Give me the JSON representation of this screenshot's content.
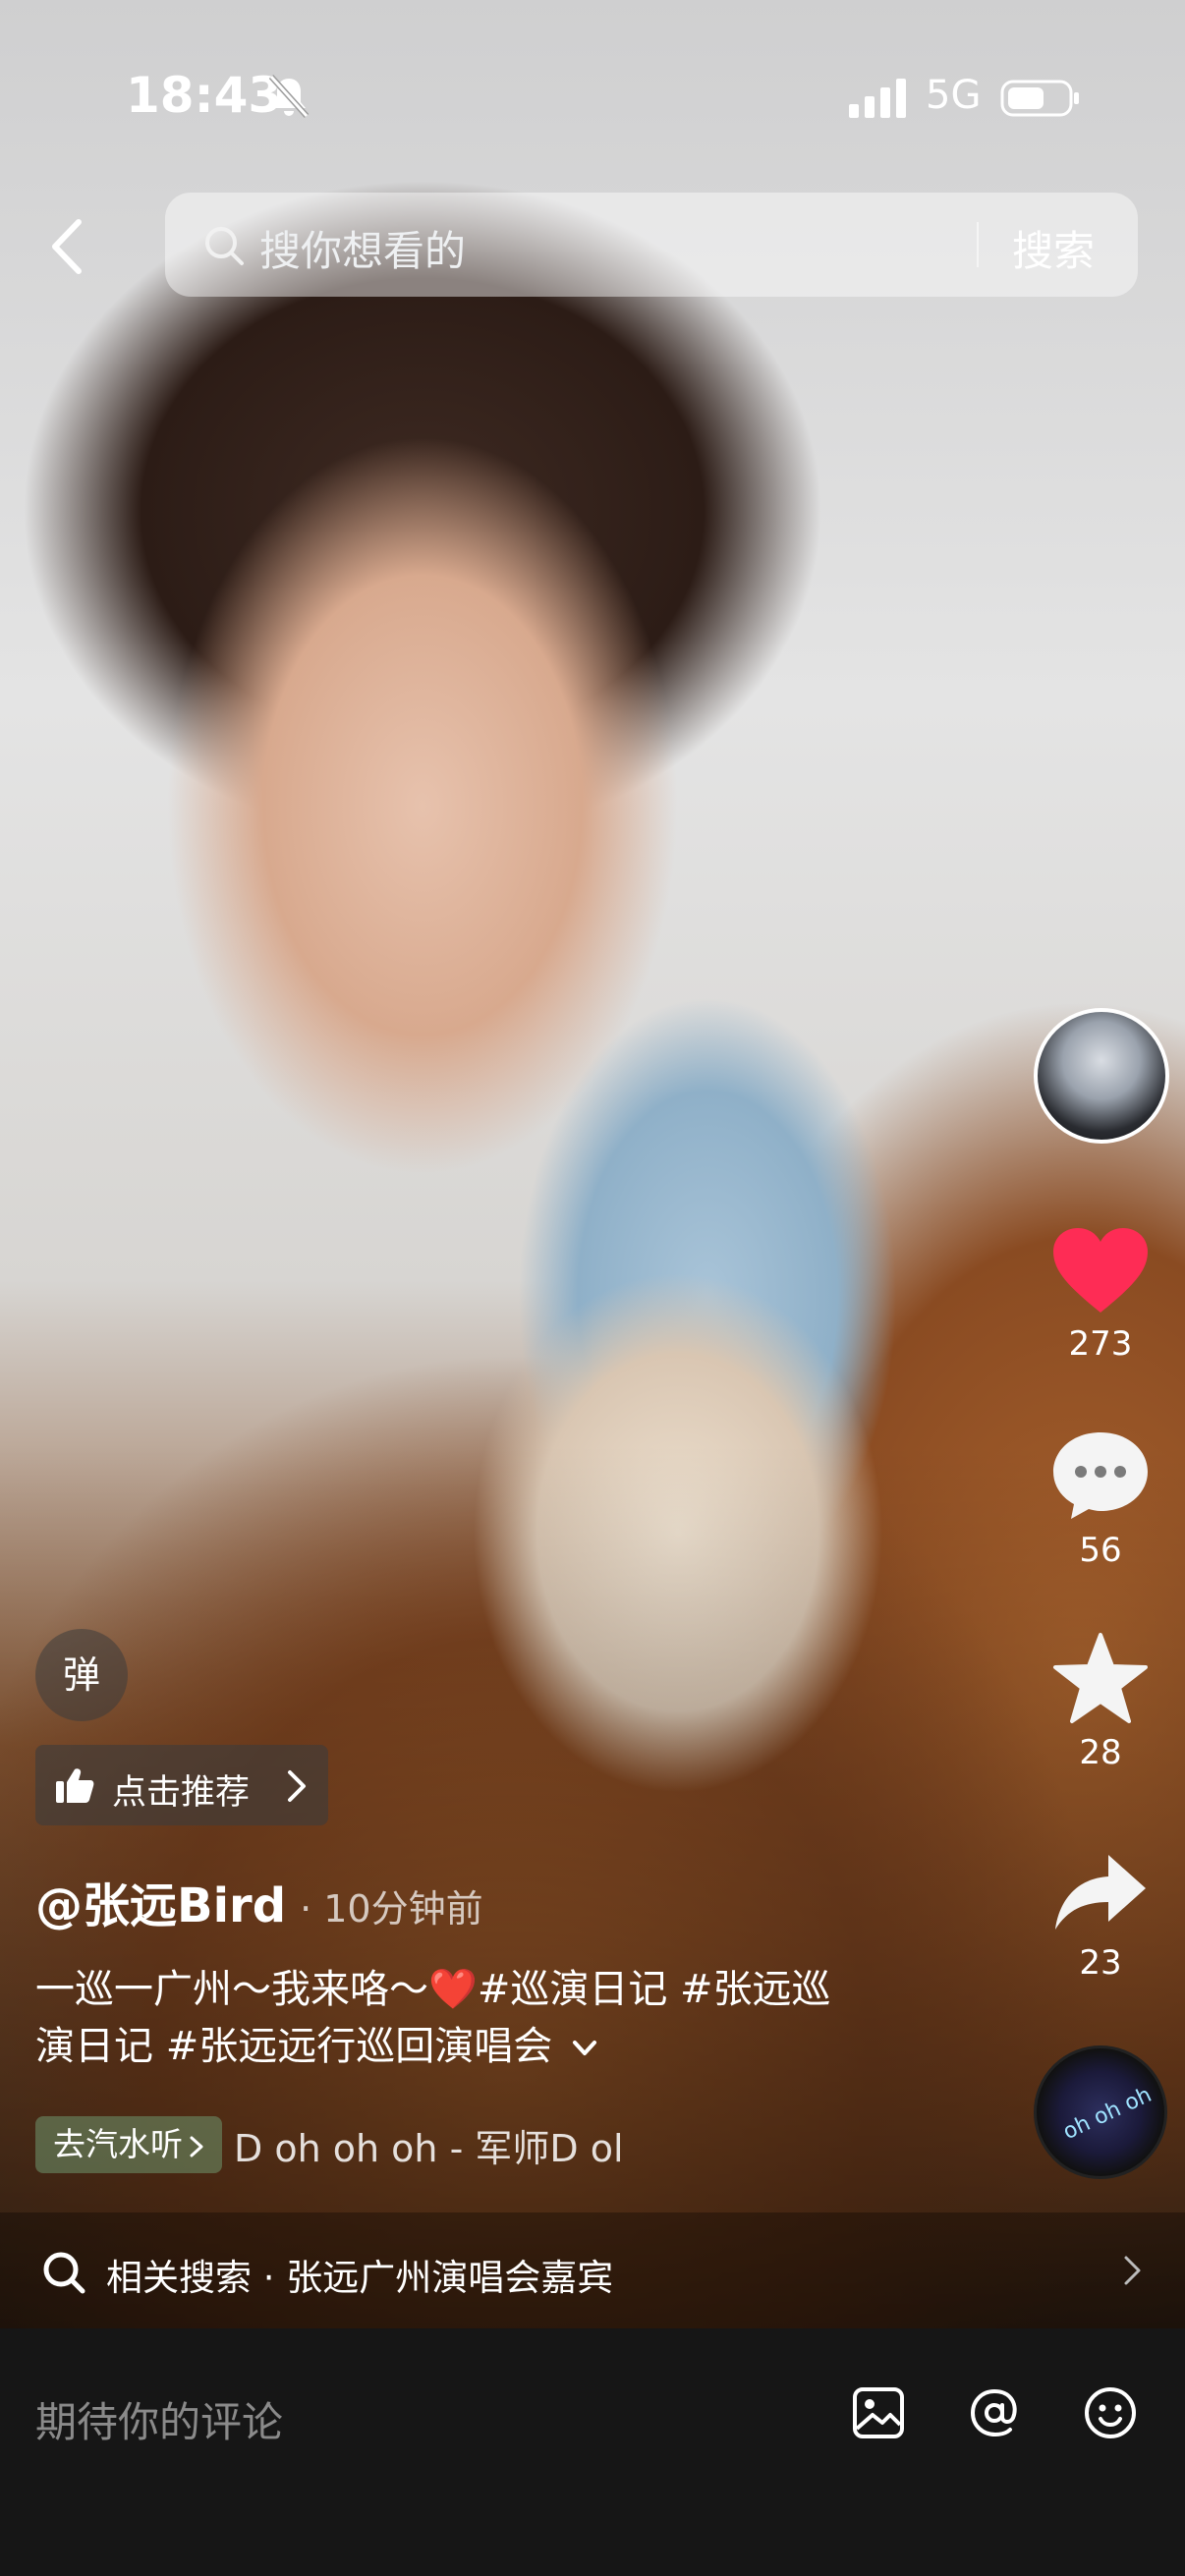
{
  "status_bar": {
    "time": "18:43",
    "network": "5G",
    "mute_icon": "bell-slash-icon",
    "signal_icon": "signal-bars-icon",
    "battery_icon": "battery-icon"
  },
  "header": {
    "back_icon": "chevron-left-icon",
    "search_icon": "search-icon",
    "search_placeholder": "搜你想看的",
    "search_button": "搜索"
  },
  "right_rail": {
    "like_count": "273",
    "comment_count": "56",
    "favorite_count": "28",
    "share_count": "23",
    "disc_label": "oh oh oh"
  },
  "overlay": {
    "danmu_label": "弹",
    "recommend_label": "点击推荐",
    "author_name": "@张远Bird",
    "post_time": "· 10分钟前",
    "caption_line1_a": "一巡一广州～我来咯～",
    "caption_heart": "❤️",
    "caption_line1_b": "#巡演日记 #张远巡",
    "caption_line2": "演日记 #张远远行巡回演唱会",
    "soda_label": "去汽水听",
    "music_title": "D   oh oh oh  -  军师D   ol"
  },
  "related": {
    "text": "相关搜索 · 张远广州演唱会嘉宾"
  },
  "comment_bar": {
    "placeholder": "期待你的评论",
    "icons": [
      "image-icon",
      "at-icon",
      "emoji-icon"
    ]
  },
  "colors": {
    "like_red": "#fe2c55",
    "background": "#161616"
  }
}
